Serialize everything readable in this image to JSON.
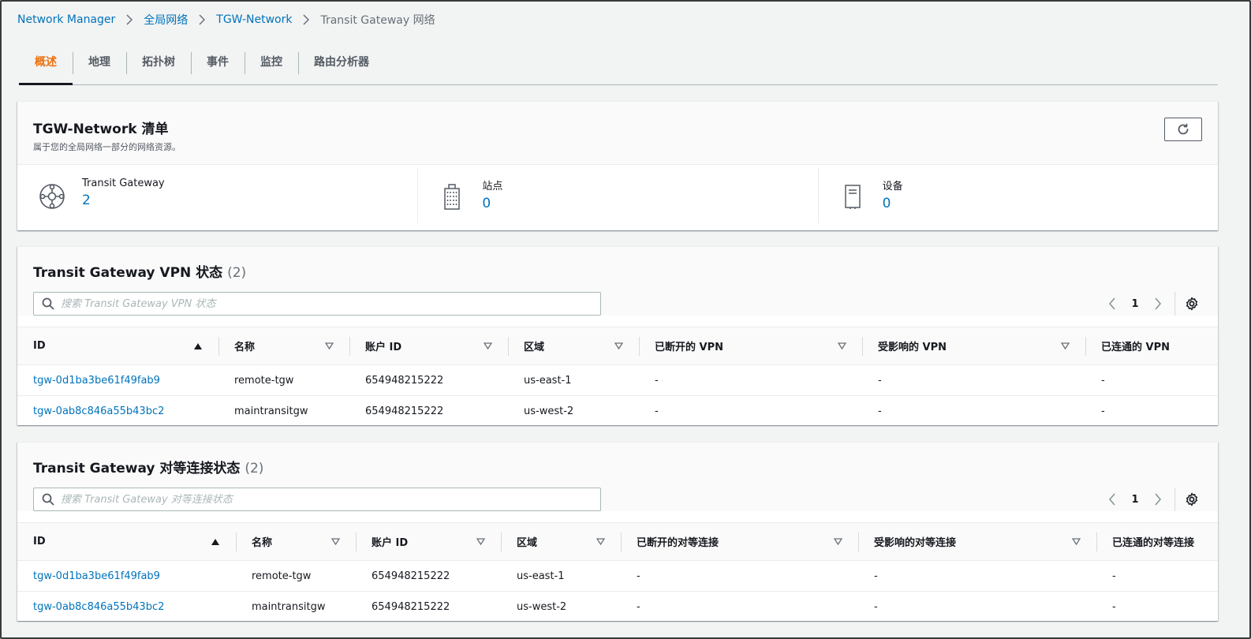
{
  "breadcrumb": [
    {
      "label": "Network Manager"
    },
    {
      "label": "全局网络"
    },
    {
      "label": "TGW-Network"
    },
    {
      "label": "Transit Gateway 网络"
    }
  ],
  "tabs": [
    {
      "label": "概述"
    },
    {
      "label": "地理"
    },
    {
      "label": "拓扑树"
    },
    {
      "label": "事件"
    },
    {
      "label": "监控"
    },
    {
      "label": "路由分析器"
    }
  ],
  "inventory": {
    "title": "TGW-Network 清单",
    "description": "属于您的全局网络一部分的网络资源。",
    "stats": [
      {
        "label": "Transit Gateway",
        "value": "2",
        "icon": "transit-gateway-icon"
      },
      {
        "label": "站点",
        "value": "0",
        "icon": "building-icon"
      },
      {
        "label": "设备",
        "value": "0",
        "icon": "device-icon"
      }
    ]
  },
  "vpn": {
    "title": "Transit Gateway VPN 状态",
    "count": "(2)",
    "search_placeholder": "搜索 Transit Gateway VPN 状态",
    "page": "1",
    "columns": [
      "ID",
      "名称",
      "账户 ID",
      "区域",
      "已断开的 VPN",
      "受影响的 VPN",
      "已连通的 VPN"
    ],
    "rows": [
      [
        "tgw-0d1ba3be61f49fab9",
        "remote-tgw",
        "654948215222",
        "us-east-1",
        "-",
        "-",
        "-"
      ],
      [
        "tgw-0ab8c846a55b43bc2",
        "maintransitgw",
        "654948215222",
        "us-west-2",
        "-",
        "-",
        "-"
      ]
    ]
  },
  "peering": {
    "title": "Transit Gateway 对等连接状态",
    "count": "(2)",
    "search_placeholder": "搜索 Transit Gateway 对等连接状态",
    "page": "1",
    "columns": [
      "ID",
      "名称",
      "账户 ID",
      "区域",
      "已断开的对等连接",
      "受影响的对等连接",
      "已连通的对等连接"
    ],
    "rows": [
      [
        "tgw-0d1ba3be61f49fab9",
        "remote-tgw",
        "654948215222",
        "us-east-1",
        "-",
        "-",
        "-"
      ],
      [
        "tgw-0ab8c846a55b43bc2",
        "maintransitgw",
        "654948215222",
        "us-west-2",
        "-",
        "-",
        "-"
      ]
    ]
  },
  "colors": {
    "link": "#0073bb",
    "active_tab": "#ec7211"
  }
}
